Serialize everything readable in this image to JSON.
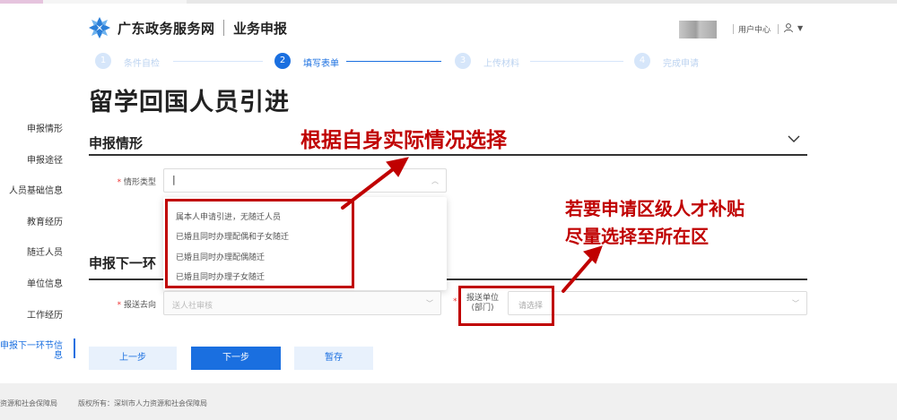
{
  "header": {
    "brand": "广东政务服务网",
    "subtitle": "业务申报",
    "user_center": "用户中心"
  },
  "steps": [
    {
      "num": "1",
      "label": "条件自检"
    },
    {
      "num": "2",
      "label": "填写表单"
    },
    {
      "num": "3",
      "label": "上传材料"
    },
    {
      "num": "4",
      "label": "完成申请"
    }
  ],
  "page_title": "留学回国人员引进",
  "sidebar": {
    "items": [
      {
        "label": "申报情形"
      },
      {
        "label": "申报途径"
      },
      {
        "label": "人员基础信息"
      },
      {
        "label": "教育经历"
      },
      {
        "label": "随迁人员"
      },
      {
        "label": "单位信息"
      },
      {
        "label": "工作经历"
      },
      {
        "label": "申报下一环节信",
        "label2": "息"
      }
    ]
  },
  "section1": {
    "title": "申报情形",
    "field_label": "情形类型",
    "required_mark": "*",
    "value": "|"
  },
  "dropdown": {
    "options": [
      "属本人申请引进，无随迁人员",
      "已婚且同时办理配偶和子女随迁",
      "已婚且同时办理配偶随迁",
      "已婚且同时办理子女随迁"
    ]
  },
  "section2": {
    "title": "申报下一环",
    "field1_label": "报送去向",
    "field1_placeholder": "送人社审核",
    "field2_label_line1": "报送单位",
    "field2_label_line2": "(部门)",
    "field2_placeholder": "请选择",
    "required_mark": "*"
  },
  "annotations": {
    "top": "根据自身实际情况选择",
    "right_line1": "若要申请区级人才补贴",
    "right_line2": "尽量选择至所在区"
  },
  "buttons": {
    "prev": "上一步",
    "next": "下一步",
    "save": "暂存"
  },
  "footer": {
    "line1_a": "资源和社会保障局",
    "line1_b": "版权所有：深圳市人力资源和社会保障局"
  },
  "colors": {
    "primary": "#1a6fe0",
    "annotation": "#c00000",
    "light_button": "#e8f1fc"
  }
}
